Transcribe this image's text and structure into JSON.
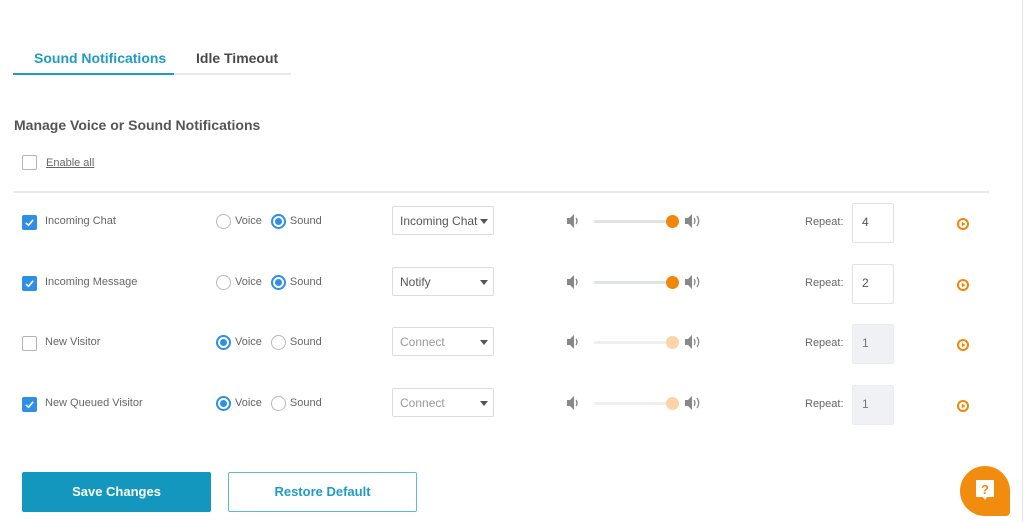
{
  "tabs": [
    {
      "label": "Sound Notifications",
      "active": true
    },
    {
      "label": "Idle Timeout",
      "active": false
    }
  ],
  "section_title": "Manage Voice or Sound Notifications",
  "enable_all": {
    "label": "Enable all",
    "checked": false
  },
  "radio_labels": {
    "voice": "Voice",
    "sound": "Sound"
  },
  "repeat_label": "Repeat:",
  "rows": [
    {
      "name": "Incoming Chat",
      "enabled": true,
      "mode": "sound",
      "sound": "Incoming Chat",
      "volume_pct": 100,
      "repeat": "4",
      "disabled": false
    },
    {
      "name": "Incoming Message",
      "enabled": true,
      "mode": "sound",
      "sound": "Notify",
      "volume_pct": 100,
      "repeat": "2",
      "disabled": false
    },
    {
      "name": "New Visitor",
      "enabled": false,
      "mode": "voice",
      "sound": "Connect",
      "volume_pct": 100,
      "repeat": "1",
      "disabled": true
    },
    {
      "name": "New Queued Visitor",
      "enabled": true,
      "mode": "voice",
      "sound": "Connect",
      "volume_pct": 100,
      "repeat": "1",
      "disabled": true
    }
  ],
  "buttons": {
    "save": "Save Changes",
    "restore": "Restore Default"
  },
  "icons": {
    "volume_low": "speaker-low-icon",
    "volume_high": "speaker-high-icon",
    "play": "play-circle-icon",
    "help": "help-question-icon"
  },
  "colors": {
    "primary": "#1497bf",
    "accent": "#f0860a",
    "checkbox": "#2d8fe5"
  }
}
